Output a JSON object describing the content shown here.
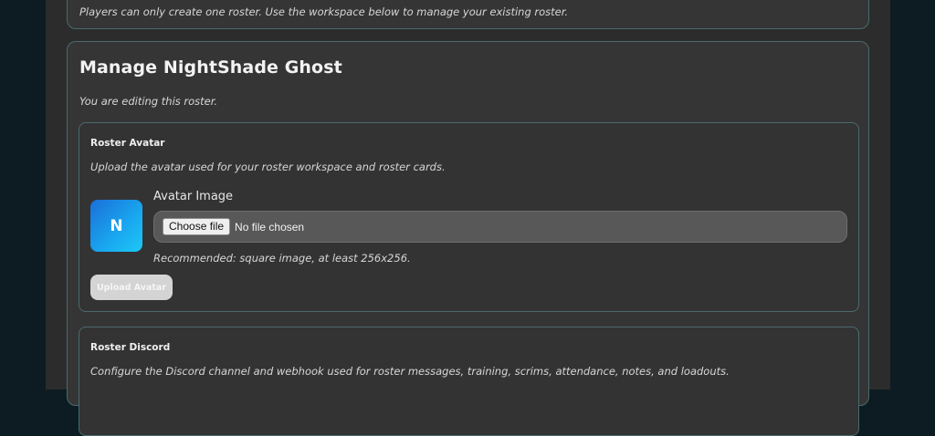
{
  "top_card": {
    "note": "Players can only create one roster. Use the workspace below to manage your existing roster."
  },
  "manage": {
    "title": "Manage NightShade Ghost",
    "subtitle": "You are editing this roster."
  },
  "avatar_panel": {
    "title": "Roster Avatar",
    "description": "Upload the avatar used for your roster workspace and roster cards.",
    "avatar_letter": "N",
    "field_label": "Avatar Image",
    "choose_button": "Choose file",
    "file_status": "No file chosen",
    "hint": "Recommended: square image, at least 256x256.",
    "upload_button": "Upload Avatar",
    "avatar_colors": [
      "#1a6fd8",
      "#1ec8f5"
    ]
  },
  "discord_panel": {
    "title": "Roster Discord",
    "description": "Configure the Discord channel and webhook used for roster messages, training, scrims, attendance, notes, and loadouts."
  },
  "theme": {
    "page_bg": "#0c1c22",
    "card_bg": "#353535",
    "border": "#4b6a6e"
  }
}
